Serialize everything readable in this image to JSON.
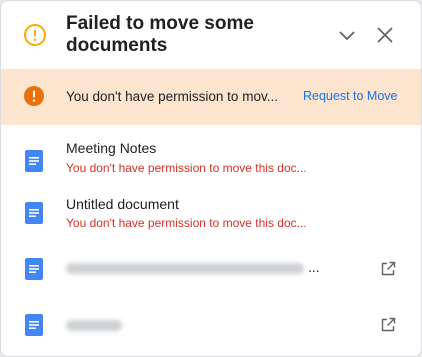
{
  "dialog": {
    "title": "Failed to move some documents",
    "header_icon": "warning-circle-icon",
    "collapse_icon": "chevron-down-icon",
    "close_icon": "close-icon"
  },
  "banner": {
    "icon": "error-circle-icon",
    "message": "You don't have permission to mov...",
    "action_label": "Request to Move"
  },
  "documents": [
    {
      "name": "Meeting Notes",
      "error": "You don't have permission to move this doc..."
    },
    {
      "name": "Untitled document",
      "error": "You don't have permission to move this doc..."
    },
    {
      "name_visible": false,
      "name_suffix": "...",
      "action_icon": "open-in-new-icon"
    },
    {
      "name_visible": false,
      "action_icon": "open-in-new-icon"
    }
  ],
  "colors": {
    "banner_bg": "#fce4cf",
    "warning_yellow": "#f9ab00",
    "error_orange": "#e8710a",
    "doc_blue": "#4285f4",
    "error_red": "#d93025",
    "link_blue": "#1a73e8"
  }
}
